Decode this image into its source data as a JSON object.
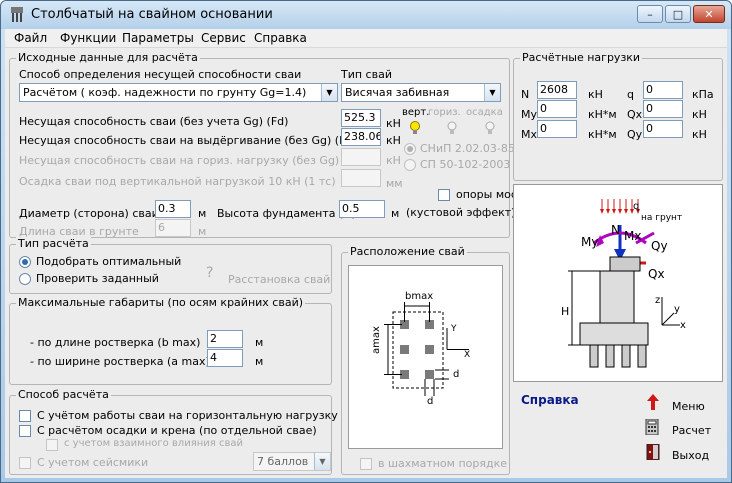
{
  "window": {
    "title": "Столбчатый на свайном основании"
  },
  "menu": [
    "Файл",
    "Функции",
    "Параметры",
    "Сервис",
    "Справка"
  ],
  "input_group": {
    "title": "Исходные данные для расчёта",
    "method_label": "Способ определения несущей способности сваи",
    "method_value": "Расчётом  ( коэф. надежности по грунту Gg=1.4)",
    "pile_type_label": "Тип свай",
    "pile_type_value": "Висячая забивная",
    "fd_label": "Несущая способность сваи  (без учета Gg)  (Fd)",
    "fd_value": "525.3",
    "fd_unit": "кН",
    "fdu_label": "Несущая способность сваи на выдёргивание  (без Gg)  (Fdu)",
    "fdu_value": "238.06",
    "fdu_unit": "кН",
    "fdq_label": "Несущая способность сваи на гориз. нагрузку (без Gg) (Fdq)",
    "fdq_unit": "кН",
    "settle_label": "Осадка сваи под вертикальной нагрузкой 10 кН (1 тс)",
    "settle_unit": "мм",
    "tab_vert": "верт.",
    "tab_horiz": "гориз.",
    "tab_settle": "осадка",
    "norm1": "СНиП 2.02.03-85",
    "norm2": "СП 50-102-2003",
    "bridge_label": "опоры мостов",
    "bridge_label2": "(кустовой эффект)",
    "diam_label": "Диаметр (сторона) сваи",
    "diam_value": "0.3",
    "diam_unit": "м",
    "height_label": "Высота фундамента (H)",
    "height_value": "0.5",
    "height_unit": "м",
    "length_label": "Длина сваи в грунте",
    "length_value": "6",
    "length_unit": "м"
  },
  "calc_type": {
    "title": "Тип расчёта",
    "opt1": "Подобрать оптимальный",
    "opt2": "Проверить заданный",
    "placement": "Расстановка свай",
    "help_glyph": "?"
  },
  "dims": {
    "title": "Максимальные габариты  (по осям крайних свай)",
    "b_label": "- по длине ростверка (b max)",
    "b_value": "2",
    "b_unit": "м",
    "a_label": "- по ширине ростверка (a max)",
    "a_value": "4",
    "a_unit": "м"
  },
  "method": {
    "title": "Способ расчёта",
    "opt1": "С учётом работы сваи на горизонтальную нагрузку",
    "opt2": "С расчётом осадки и крена  (по отдельной свае)",
    "opt3": "с учетом взаимного влияния свай",
    "opt4": "С учетом сейсмики",
    "seismic_value": "7 баллов"
  },
  "layout": {
    "title": "Расположение свай",
    "bmax": "bmax",
    "amax": "amax",
    "y": "Y",
    "x": "X",
    "d": "d",
    "chess": "в шахматном порядке"
  },
  "loads": {
    "title": "Расчётные нагрузки",
    "n_label": "N",
    "n_value": "2608",
    "n_unit": "кН",
    "my_label": "My",
    "my_value": "0",
    "my_unit": "кН*м",
    "mx_label": "Mx",
    "mx_value": "0",
    "mx_unit": "кН*м",
    "q_label": "q",
    "q_value": "0",
    "q_unit": "кПа",
    "qx_label": "Qx",
    "qx_value": "0",
    "qx_unit": "кН",
    "qy_label": "Qy",
    "qy_value": "0",
    "qy_unit": "кН"
  },
  "scheme": {
    "q": "q",
    "ground": "на грунт",
    "n": "N",
    "my": "My",
    "mx": "Mx",
    "qy": "Qy",
    "qx": "Qx",
    "h": "H",
    "z": "z",
    "y": "y",
    "x": "x"
  },
  "actions": {
    "help": "Справка",
    "menu": "Меню",
    "calc": "Расчет",
    "exit": "Выход"
  },
  "colors": {
    "help_link": "#0a1a8a",
    "arrow_red": "#d01818",
    "load_purple": "#b000c0"
  }
}
